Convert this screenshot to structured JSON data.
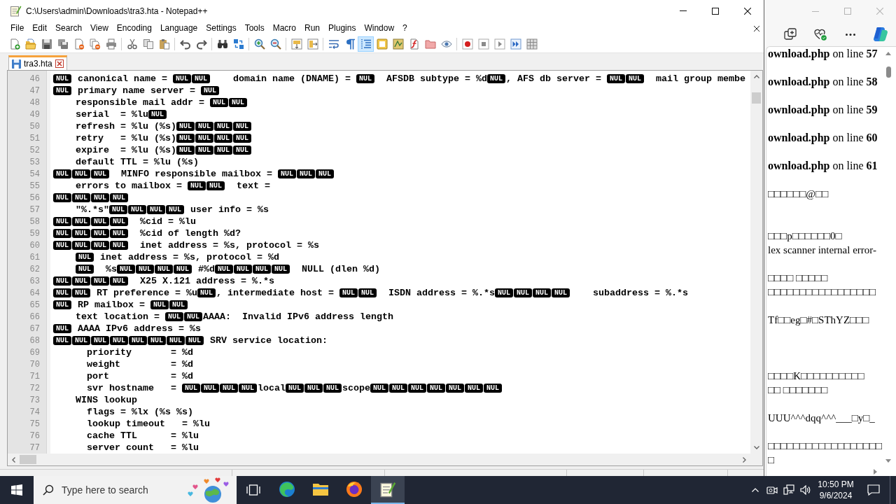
{
  "notepad_window": {
    "title": "C:\\Users\\admin\\Downloads\\tra3.hta - Notepad++",
    "menu": [
      "File",
      "Edit",
      "Search",
      "View",
      "Encoding",
      "Language",
      "Settings",
      "Tools",
      "Macro",
      "Run",
      "Plugins",
      "Window",
      "?"
    ],
    "toolbar": [
      [
        {
          "on": false
        },
        {
          "on": false
        },
        {
          "on": false
        },
        {
          "on": false
        },
        {
          "on": false
        },
        {
          "on": false
        },
        {
          "on": false
        }
      ],
      [
        {
          "on": false
        },
        {
          "on": false
        },
        {
          "on": false
        }
      ],
      [
        {
          "on": false
        },
        {
          "on": false
        }
      ],
      [
        {
          "on": false
        },
        {
          "on": false
        }
      ],
      [
        {
          "on": false
        },
        {
          "on": false
        }
      ],
      [
        {
          "on": false
        },
        {
          "on": false
        }
      ],
      [
        {
          "on": false
        },
        {
          "on": false
        },
        {
          "on": true
        },
        {
          "on": false
        },
        {
          "on": false
        },
        {
          "on": false
        },
        {
          "on": false
        },
        {
          "on": false
        }
      ],
      [
        {
          "on": false
        },
        {
          "on": false
        },
        {
          "on": false
        },
        {
          "on": false
        },
        {
          "on": false
        }
      ]
    ],
    "tabs": [
      {
        "label": "tra3.hta",
        "selected": true
      }
    ],
    "editor": {
      "lines": [
        {
          "number": "46",
          "segments": [
            {
              "kind": "nul",
              "text": "NUL"
            },
            {
              "kind": "text",
              "text": " canonical name = "
            },
            {
              "kind": "nul",
              "text": "NUL"
            },
            {
              "kind": "nul",
              "text": "NUL"
            },
            {
              "kind": "text",
              "text": "    domain name (DNAME) = "
            },
            {
              "kind": "nul",
              "text": "NUL"
            },
            {
              "kind": "text",
              "text": "  AFSDB subtype = %d"
            },
            {
              "kind": "nul",
              "text": "NUL"
            },
            {
              "kind": "text",
              "text": ", AFS db server = "
            },
            {
              "kind": "nul",
              "text": "NUL"
            },
            {
              "kind": "nul",
              "text": "NUL"
            },
            {
              "kind": "text",
              "text": "  mail group membe"
            }
          ]
        },
        {
          "number": "47",
          "segments": [
            {
              "kind": "nul",
              "text": "NUL"
            },
            {
              "kind": "text",
              "text": " primary name server = "
            },
            {
              "kind": "nul",
              "text": "NUL"
            }
          ]
        },
        {
          "number": "48",
          "segments": [
            {
              "kind": "text",
              "text": "    responsible mail addr = "
            },
            {
              "kind": "nul",
              "text": "NUL"
            },
            {
              "kind": "nul",
              "text": "NUL"
            }
          ]
        },
        {
          "number": "49",
          "segments": [
            {
              "kind": "text",
              "text": "    serial  = %lu"
            },
            {
              "kind": "nul",
              "text": "NUL"
            }
          ]
        },
        {
          "number": "50",
          "segments": [
            {
              "kind": "text",
              "text": "    refresh = %lu (%s)"
            },
            {
              "kind": "nul",
              "text": "NUL"
            },
            {
              "kind": "nul",
              "text": "NUL"
            },
            {
              "kind": "nul",
              "text": "NUL"
            },
            {
              "kind": "nul",
              "text": "NUL"
            }
          ]
        },
        {
          "number": "51",
          "segments": [
            {
              "kind": "text",
              "text": "    retry   = %lu (%s)"
            },
            {
              "kind": "nul",
              "text": "NUL"
            },
            {
              "kind": "nul",
              "text": "NUL"
            },
            {
              "kind": "nul",
              "text": "NUL"
            },
            {
              "kind": "nul",
              "text": "NUL"
            }
          ]
        },
        {
          "number": "52",
          "segments": [
            {
              "kind": "text",
              "text": "    expire  = %lu (%s)"
            },
            {
              "kind": "nul",
              "text": "NUL"
            },
            {
              "kind": "nul",
              "text": "NUL"
            },
            {
              "kind": "nul",
              "text": "NUL"
            },
            {
              "kind": "nul",
              "text": "NUL"
            }
          ]
        },
        {
          "number": "53",
          "segments": [
            {
              "kind": "text",
              "text": "    default TTL = %lu (%s)"
            }
          ]
        },
        {
          "number": "54",
          "segments": [
            {
              "kind": "nul",
              "text": "NUL"
            },
            {
              "kind": "nul",
              "text": "NUL"
            },
            {
              "kind": "nul",
              "text": "NUL"
            },
            {
              "kind": "text",
              "text": "  MINFO responsible mailbox = "
            },
            {
              "kind": "nul",
              "text": "NUL"
            },
            {
              "kind": "nul",
              "text": "NUL"
            },
            {
              "kind": "nul",
              "text": "NUL"
            }
          ]
        },
        {
          "number": "55",
          "segments": [
            {
              "kind": "text",
              "text": "    errors to mailbox = "
            },
            {
              "kind": "nul",
              "text": "NUL"
            },
            {
              "kind": "nul",
              "text": "NUL"
            },
            {
              "kind": "text",
              "text": "  text ="
            }
          ]
        },
        {
          "number": "56",
          "segments": [
            {
              "kind": "nul",
              "text": "NUL"
            },
            {
              "kind": "nul",
              "text": "NUL"
            },
            {
              "kind": "nul",
              "text": "NUL"
            },
            {
              "kind": "nul",
              "text": "NUL"
            }
          ]
        },
        {
          "number": "57",
          "segments": [
            {
              "kind": "text",
              "text": "    \"%.*s\""
            },
            {
              "kind": "nul",
              "text": "NUL"
            },
            {
              "kind": "nul",
              "text": "NUL"
            },
            {
              "kind": "nul",
              "text": "NUL"
            },
            {
              "kind": "nul",
              "text": "NUL"
            },
            {
              "kind": "text",
              "text": " user info = %s"
            }
          ]
        },
        {
          "number": "58",
          "segments": [
            {
              "kind": "nul",
              "text": "NUL"
            },
            {
              "kind": "nul",
              "text": "NUL"
            },
            {
              "kind": "nul",
              "text": "NUL"
            },
            {
              "kind": "nul",
              "text": "NUL"
            },
            {
              "kind": "text",
              "text": "  %cid = %lu"
            }
          ]
        },
        {
          "number": "59",
          "segments": [
            {
              "kind": "nul",
              "text": "NUL"
            },
            {
              "kind": "nul",
              "text": "NUL"
            },
            {
              "kind": "nul",
              "text": "NUL"
            },
            {
              "kind": "nul",
              "text": "NUL"
            },
            {
              "kind": "text",
              "text": "  %cid of length %d?"
            }
          ]
        },
        {
          "number": "60",
          "segments": [
            {
              "kind": "nul",
              "text": "NUL"
            },
            {
              "kind": "nul",
              "text": "NUL"
            },
            {
              "kind": "nul",
              "text": "NUL"
            },
            {
              "kind": "nul",
              "text": "NUL"
            },
            {
              "kind": "text",
              "text": "  inet address = %s, protocol = %s"
            }
          ]
        },
        {
          "number": "61",
          "segments": [
            {
              "kind": "indent"
            },
            {
              "kind": "nul",
              "text": "NUL"
            },
            {
              "kind": "text",
              "text": " inet address = %s, protocol = %d"
            }
          ]
        },
        {
          "number": "62",
          "segments": [
            {
              "kind": "indent"
            },
            {
              "kind": "nul",
              "text": "NUL"
            },
            {
              "kind": "text",
              "text": "  %s"
            },
            {
              "kind": "nul",
              "text": "NUL"
            },
            {
              "kind": "nul",
              "text": "NUL"
            },
            {
              "kind": "nul",
              "text": "NUL"
            },
            {
              "kind": "nul",
              "text": "NUL"
            },
            {
              "kind": "text",
              "text": " #%d"
            },
            {
              "kind": "nul",
              "text": "NUL"
            },
            {
              "kind": "nul",
              "text": "NUL"
            },
            {
              "kind": "nul",
              "text": "NUL"
            },
            {
              "kind": "nul",
              "text": "NUL"
            },
            {
              "kind": "text",
              "text": "  NULL (dlen %d)"
            }
          ]
        },
        {
          "number": "63",
          "segments": [
            {
              "kind": "nul",
              "text": "NUL"
            },
            {
              "kind": "nul",
              "text": "NUL"
            },
            {
              "kind": "nul",
              "text": "NUL"
            },
            {
              "kind": "nul",
              "text": "NUL"
            },
            {
              "kind": "text",
              "text": "  X25 X.121 address = %.*s"
            }
          ]
        },
        {
          "number": "64",
          "segments": [
            {
              "kind": "nul",
              "text": "NUL"
            },
            {
              "kind": "nul",
              "text": "NUL"
            },
            {
              "kind": "text",
              "text": " RT preference = %u"
            },
            {
              "kind": "nul",
              "text": "NUL"
            },
            {
              "kind": "text",
              "text": ", intermediate host = "
            },
            {
              "kind": "nul",
              "text": "NUL"
            },
            {
              "kind": "nul",
              "text": "NUL"
            },
            {
              "kind": "text",
              "text": "  ISDN address = %.*s"
            },
            {
              "kind": "nul",
              "text": "NUL"
            },
            {
              "kind": "nul",
              "text": "NUL"
            },
            {
              "kind": "nul",
              "text": "NUL"
            },
            {
              "kind": "nul",
              "text": "NUL"
            },
            {
              "kind": "text",
              "text": "    subaddress = %.*s"
            }
          ]
        },
        {
          "number": "65",
          "segments": [
            {
              "kind": "nul",
              "text": "NUL"
            },
            {
              "kind": "text",
              "text": " RP mailbox = "
            },
            {
              "kind": "nul",
              "text": "NUL"
            },
            {
              "kind": "nul",
              "text": "NUL"
            }
          ]
        },
        {
          "number": "66",
          "segments": [
            {
              "kind": "text",
              "text": "    text location = "
            },
            {
              "kind": "nul",
              "text": "NUL"
            },
            {
              "kind": "nul",
              "text": "NUL"
            },
            {
              "kind": "text",
              "text": "AAAA:  Invalid IPv6 address length"
            }
          ]
        },
        {
          "number": "67",
          "segments": [
            {
              "kind": "nul",
              "text": "NUL"
            },
            {
              "kind": "text",
              "text": " AAAA IPv6 address = %s"
            }
          ]
        },
        {
          "number": "68",
          "segments": [
            {
              "kind": "nul",
              "text": "NUL"
            },
            {
              "kind": "nul",
              "text": "NUL"
            },
            {
              "kind": "nul",
              "text": "NUL"
            },
            {
              "kind": "nul",
              "text": "NUL"
            },
            {
              "kind": "nul",
              "text": "NUL"
            },
            {
              "kind": "nul",
              "text": "NUL"
            },
            {
              "kind": "nul",
              "text": "NUL"
            },
            {
              "kind": "nul",
              "text": "NUL"
            },
            {
              "kind": "text",
              "text": " SRV service location:"
            }
          ]
        },
        {
          "number": "69",
          "segments": [
            {
              "kind": "text",
              "text": "      priority       = %d"
            }
          ]
        },
        {
          "number": "70",
          "segments": [
            {
              "kind": "text",
              "text": "      weight         = %d"
            }
          ]
        },
        {
          "number": "71",
          "segments": [
            {
              "kind": "text",
              "text": "      port           = %d"
            }
          ]
        },
        {
          "number": "72",
          "segments": [
            {
              "kind": "text",
              "text": "      svr hostname   = "
            },
            {
              "kind": "nul",
              "text": "NUL"
            },
            {
              "kind": "nul",
              "text": "NUL"
            },
            {
              "kind": "nul",
              "text": "NUL"
            },
            {
              "kind": "nul",
              "text": "NUL"
            },
            {
              "kind": "text",
              "text": "local"
            },
            {
              "kind": "nul",
              "text": "NUL"
            },
            {
              "kind": "nul",
              "text": "NUL"
            },
            {
              "kind": "nul",
              "text": "NUL"
            },
            {
              "kind": "text",
              "text": "scope"
            },
            {
              "kind": "nul",
              "text": "NUL"
            },
            {
              "kind": "nul",
              "text": "NUL"
            },
            {
              "kind": "nul",
              "text": "NUL"
            },
            {
              "kind": "nul",
              "text": "NUL"
            },
            {
              "kind": "nul",
              "text": "NUL"
            },
            {
              "kind": "nul",
              "text": "NUL"
            },
            {
              "kind": "nul",
              "text": "NUL"
            }
          ]
        },
        {
          "number": "73",
          "segments": [
            {
              "kind": "text",
              "text": "    WINS lookup"
            }
          ]
        },
        {
          "number": "74",
          "segments": [
            {
              "kind": "text",
              "text": "      flags = %lx (%s %s)"
            }
          ]
        },
        {
          "number": "75",
          "segments": [
            {
              "kind": "text",
              "text": "      lookup timeout   = %lu"
            }
          ]
        },
        {
          "number": "76",
          "segments": [
            {
              "kind": "text",
              "text": "      cache TTL      = %lu"
            }
          ]
        },
        {
          "number": "77",
          "segments": [
            {
              "kind": "text",
              "text": "      server count   = %lu"
            }
          ]
        }
      ]
    }
  },
  "browser_window": {
    "blocks": [
      {
        "kind": "log",
        "lines": [
          "**ownload.php** on line **57**"
        ]
      },
      {
        "kind": "log",
        "lines": [
          "**ownload.php** on line **58**"
        ]
      },
      {
        "kind": "log",
        "lines": [
          "**ownload.php** on line **59**"
        ]
      },
      {
        "kind": "log",
        "lines": [
          "**ownload.php** on line **60**"
        ]
      },
      {
        "kind": "log",
        "lines": [
          "**ownload.php** on line **61**"
        ]
      },
      {
        "kind": "garbled",
        "lines": [
          "□□□□□□@□□"
        ]
      },
      {
        "kind": "garbled",
        "lines": [
          "□□□p□□□□□□0□",
          "lex scanner internal error-"
        ]
      },
      {
        "kind": "garbled",
        "lines": [
          "□□□□ □□□□□",
          "□□□□□□□□□□□□□□□□□"
        ]
      },
      {
        "kind": "garbled",
        "lines": [
          "Tf□□eg□#□SThYZ□□□"
        ]
      },
      {
        "kind": "garbled",
        "lines": [
          "□□□□K□□□□□□□□□□",
          "□□ □□□□□□□"
        ]
      },
      {
        "kind": "garbled",
        "lines": [
          "UUU^^^dqq^^^___□y□_"
        ]
      },
      {
        "kind": "garbled",
        "lines": [
          "□□□□□□□□□□□□□□□□□□",
          "□"
        ]
      }
    ]
  },
  "taskbar": {
    "search": {
      "placeholder": "Type here to search"
    },
    "apps": [
      {
        "selected": false
      },
      {
        "selected": false
      },
      {
        "selected": false
      },
      {
        "selected": true
      }
    ],
    "clock": {
      "time": "10:50 PM",
      "date": "9/6/2024"
    }
  }
}
